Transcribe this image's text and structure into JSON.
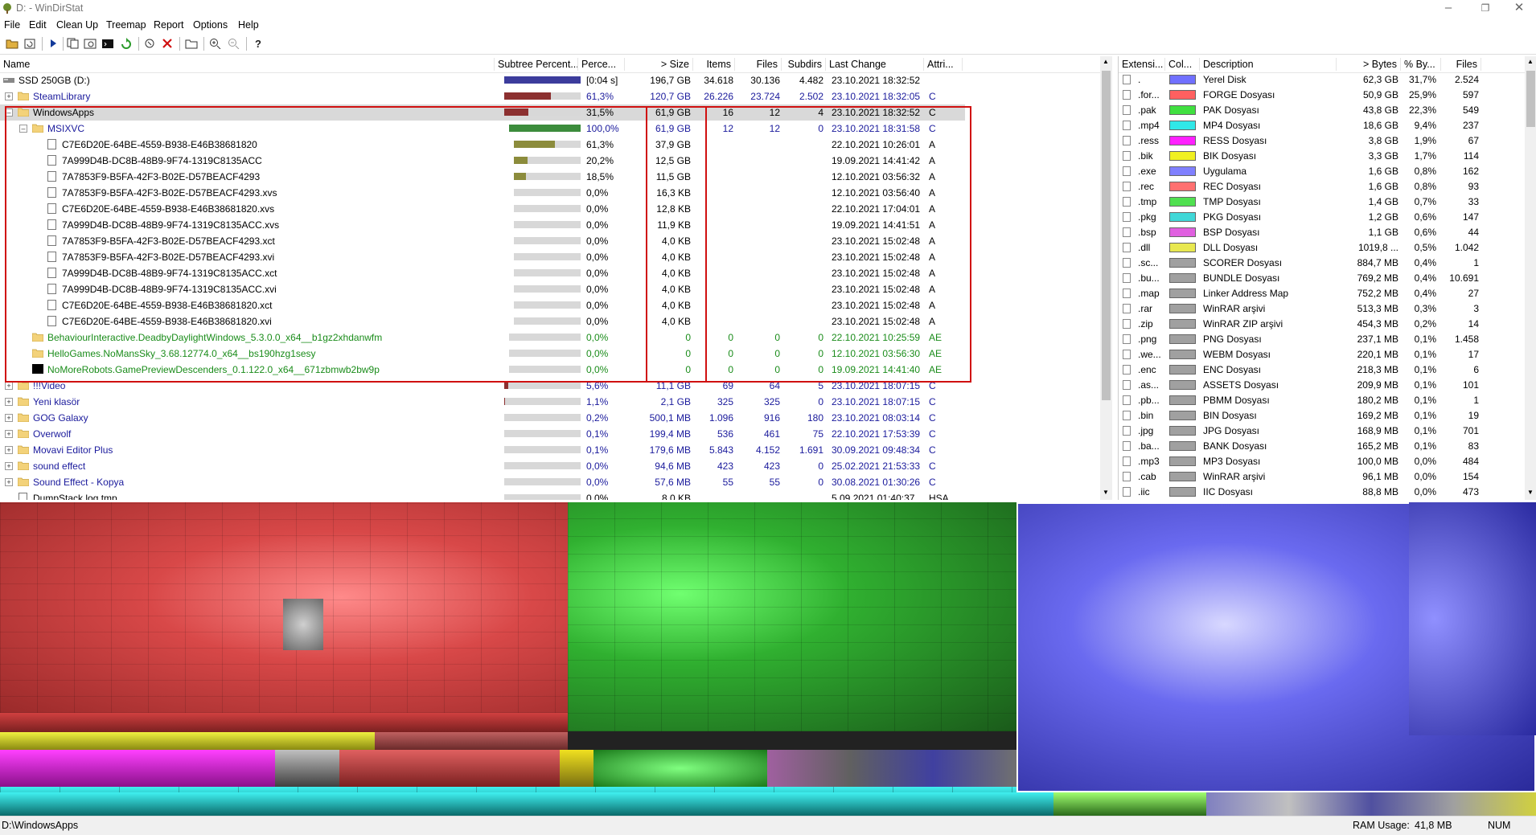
{
  "window": {
    "title": "D: - WinDirStat"
  },
  "menu": [
    "File",
    "Edit",
    "Clean Up",
    "Treemap",
    "Report",
    "Options",
    "Help"
  ],
  "toolbar": [
    "open-icon",
    "refresh-icon",
    "play-icon",
    "copy-icon",
    "explorer-icon",
    "cmd-icon",
    "cleanup-icon",
    "delete-icon",
    "folder-icon",
    "zoom-in-icon",
    "zoom-out-icon",
    "help-icon"
  ],
  "tree": {
    "columns": [
      "Name",
      "Subtree Percent...",
      "Perce...",
      "> Size",
      "Items",
      "Files",
      "Subdirs",
      "Last Change",
      "Attri..."
    ],
    "rows": [
      {
        "level": 0,
        "type": "drive",
        "name": "SSD 250GB (D:)",
        "bar": 1.0,
        "barColor": "#3c3c9c",
        "perc": "[0:04 s]",
        "size": "196,7 GB",
        "items": "34.618",
        "files": "30.136",
        "subdirs": "4.482",
        "last": "23.10.2021  18:32:52",
        "attr": ""
      },
      {
        "level": 1,
        "type": "folder",
        "expander": "+",
        "name": "SteamLibrary",
        "nameColor": "blue",
        "bar": 0.613,
        "barColor": "#8c3030",
        "perc": "61,3%",
        "size": "120,7 GB",
        "items": "26.226",
        "files": "23.724",
        "subdirs": "2.502",
        "last": "23.10.2021  18:32:05",
        "attr": "C"
      },
      {
        "level": 1,
        "type": "folder",
        "expander": "-",
        "name": "WindowsApps",
        "nameColor": "black",
        "selected": true,
        "bar": 0.315,
        "barColor": "#8c3030",
        "perc": "31,5%",
        "size": "61,9 GB",
        "items": "16",
        "files": "12",
        "subdirs": "4",
        "last": "23.10.2021  18:32:52",
        "attr": "C"
      },
      {
        "level": 2,
        "type": "folder",
        "expander": "-",
        "name": "MSIXVC",
        "nameColor": "blue",
        "bar": 1.0,
        "barColor": "#3c8c3c",
        "perc": "100,0%",
        "size": "61,9 GB",
        "items": "12",
        "files": "12",
        "subdirs": "0",
        "last": "23.10.2021  18:31:58",
        "attr": "C"
      },
      {
        "level": 3,
        "type": "file",
        "name": "C7E6D20E-64BE-4559-B938-E46B38681820",
        "bar": 0.613,
        "barColor": "#8c8c3c",
        "perc": "61,3%",
        "size": "37,9 GB",
        "items": "",
        "files": "",
        "subdirs": "",
        "last": "22.10.2021  10:26:01",
        "attr": "A"
      },
      {
        "level": 3,
        "type": "file",
        "name": "7A999D4B-DC8B-48B9-9F74-1319C8135ACC",
        "bar": 0.202,
        "barColor": "#8c8c3c",
        "perc": "20,2%",
        "size": "12,5 GB",
        "items": "",
        "files": "",
        "subdirs": "",
        "last": "19.09.2021  14:41:42",
        "attr": "A"
      },
      {
        "level": 3,
        "type": "file",
        "name": "7A7853F9-B5FA-42F3-B02E-D57BEACF4293",
        "bar": 0.185,
        "barColor": "#8c8c3c",
        "perc": "18,5%",
        "size": "11,5 GB",
        "items": "",
        "files": "",
        "subdirs": "",
        "last": "12.10.2021  03:56:32",
        "attr": "A"
      },
      {
        "level": 3,
        "type": "file",
        "name": "7A7853F9-B5FA-42F3-B02E-D57BEACF4293.xvs",
        "bar": 0,
        "barColor": "#8c8c3c",
        "perc": "0,0%",
        "size": "16,3 KB",
        "items": "",
        "files": "",
        "subdirs": "",
        "last": "12.10.2021  03:56:40",
        "attr": "A"
      },
      {
        "level": 3,
        "type": "file",
        "name": "C7E6D20E-64BE-4559-B938-E46B38681820.xvs",
        "bar": 0,
        "barColor": "#8c8c3c",
        "perc": "0,0%",
        "size": "12,8 KB",
        "items": "",
        "files": "",
        "subdirs": "",
        "last": "22.10.2021  17:04:01",
        "attr": "A"
      },
      {
        "level": 3,
        "type": "file",
        "name": "7A999D4B-DC8B-48B9-9F74-1319C8135ACC.xvs",
        "bar": 0,
        "barColor": "#8c8c3c",
        "perc": "0,0%",
        "size": "11,9 KB",
        "items": "",
        "files": "",
        "subdirs": "",
        "last": "19.09.2021  14:41:51",
        "attr": "A"
      },
      {
        "level": 3,
        "type": "file",
        "name": "7A7853F9-B5FA-42F3-B02E-D57BEACF4293.xct",
        "bar": 0,
        "barColor": "#8c8c3c",
        "perc": "0,0%",
        "size": "4,0 KB",
        "items": "",
        "files": "",
        "subdirs": "",
        "last": "23.10.2021  15:02:48",
        "attr": "A"
      },
      {
        "level": 3,
        "type": "file",
        "name": "7A7853F9-B5FA-42F3-B02E-D57BEACF4293.xvi",
        "bar": 0,
        "barColor": "#8c8c3c",
        "perc": "0,0%",
        "size": "4,0 KB",
        "items": "",
        "files": "",
        "subdirs": "",
        "last": "23.10.2021  15:02:48",
        "attr": "A"
      },
      {
        "level": 3,
        "type": "file",
        "name": "7A999D4B-DC8B-48B9-9F74-1319C8135ACC.xct",
        "bar": 0,
        "barColor": "#8c8c3c",
        "perc": "0,0%",
        "size": "4,0 KB",
        "items": "",
        "files": "",
        "subdirs": "",
        "last": "23.10.2021  15:02:48",
        "attr": "A"
      },
      {
        "level": 3,
        "type": "file",
        "name": "7A999D4B-DC8B-48B9-9F74-1319C8135ACC.xvi",
        "bar": 0,
        "barColor": "#8c8c3c",
        "perc": "0,0%",
        "size": "4,0 KB",
        "items": "",
        "files": "",
        "subdirs": "",
        "last": "23.10.2021  15:02:48",
        "attr": "A"
      },
      {
        "level": 3,
        "type": "file",
        "name": "C7E6D20E-64BE-4559-B938-E46B38681820.xct",
        "bar": 0,
        "barColor": "#8c8c3c",
        "perc": "0,0%",
        "size": "4,0 KB",
        "items": "",
        "files": "",
        "subdirs": "",
        "last": "23.10.2021  15:02:48",
        "attr": "A"
      },
      {
        "level": 3,
        "type": "file",
        "name": "C7E6D20E-64BE-4559-B938-E46B38681820.xvi",
        "bar": 0,
        "barColor": "#8c8c3c",
        "perc": "0,0%",
        "size": "4,0 KB",
        "items": "",
        "files": "",
        "subdirs": "",
        "last": "23.10.2021  15:02:48",
        "attr": "A"
      },
      {
        "level": 2,
        "type": "folder",
        "name": "BehaviourInteractive.DeadbyDaylightWindows_5.3.0.0_x64__b1gz2xhdanwfm",
        "nameColor": "green",
        "bar": 0,
        "barColor": "#3c8c3c",
        "perc": "0,0%",
        "size": "0",
        "items": "0",
        "files": "0",
        "subdirs": "0",
        "last": "22.10.2021  10:25:59",
        "attr": "AE",
        "attrColor": "green"
      },
      {
        "level": 2,
        "type": "folder",
        "name": "HelloGames.NoMansSky_3.68.12774.0_x64__bs190hzg1sesy",
        "nameColor": "green",
        "bar": 0,
        "barColor": "#3c8c3c",
        "perc": "0,0%",
        "size": "0",
        "items": "0",
        "files": "0",
        "subdirs": "0",
        "last": "12.10.2021  03:56:30",
        "attr": "AE",
        "attrColor": "green"
      },
      {
        "level": 2,
        "type": "blackfolder",
        "name": "NoMoreRobots.GamePreviewDescenders_0.1.122.0_x64__671zbmwb2bw9p",
        "nameColor": "green",
        "bar": 0,
        "barColor": "#3c8c3c",
        "perc": "0,0%",
        "size": "0",
        "items": "0",
        "files": "0",
        "subdirs": "0",
        "last": "19.09.2021  14:41:40",
        "attr": "AE",
        "attrColor": "green"
      },
      {
        "level": 1,
        "type": "folder",
        "expander": "+",
        "name": "!!!Video",
        "nameColor": "blue",
        "bar": 0.056,
        "barColor": "#8c3030",
        "perc": "5,6%",
        "size": "11,1 GB",
        "items": "69",
        "files": "64",
        "subdirs": "5",
        "last": "23.10.2021  18:07:15",
        "attr": "C"
      },
      {
        "level": 1,
        "type": "folder",
        "expander": "+",
        "name": "Yeni klasör",
        "nameColor": "blue",
        "bar": 0.011,
        "barColor": "#8c3030",
        "perc": "1,1%",
        "size": "2,1 GB",
        "items": "325",
        "files": "325",
        "subdirs": "0",
        "last": "23.10.2021  18:07:15",
        "attr": "C"
      },
      {
        "level": 1,
        "type": "folder",
        "expander": "+",
        "name": "GOG Galaxy",
        "nameColor": "blue",
        "bar": 0.002,
        "barColor": "#8c3030",
        "perc": "0,2%",
        "size": "500,1 MB",
        "items": "1.096",
        "files": "916",
        "subdirs": "180",
        "last": "23.10.2021  08:03:14",
        "attr": "C"
      },
      {
        "level": 1,
        "type": "folder",
        "expander": "+",
        "name": "Overwolf",
        "nameColor": "blue",
        "bar": 0.001,
        "barColor": "#8c3030",
        "perc": "0,1%",
        "size": "199,4 MB",
        "items": "536",
        "files": "461",
        "subdirs": "75",
        "last": "22.10.2021  17:53:39",
        "attr": "C"
      },
      {
        "level": 1,
        "type": "folder",
        "expander": "+",
        "name": "Movavi Editor Plus",
        "nameColor": "blue",
        "bar": 0.001,
        "barColor": "#8c3030",
        "perc": "0,1%",
        "size": "179,6 MB",
        "items": "5.843",
        "files": "4.152",
        "subdirs": "1.691",
        "last": "30.09.2021  09:48:34",
        "attr": "C"
      },
      {
        "level": 1,
        "type": "folder",
        "expander": "+",
        "name": "sound effect",
        "nameColor": "blue",
        "bar": 0,
        "barColor": "#8c3030",
        "perc": "0,0%",
        "size": "94,6 MB",
        "items": "423",
        "files": "423",
        "subdirs": "0",
        "last": "25.02.2021  21:53:33",
        "attr": "C"
      },
      {
        "level": 1,
        "type": "folder",
        "expander": "+",
        "name": "Sound Effect - Kopya",
        "nameColor": "blue",
        "bar": 0,
        "barColor": "#8c3030",
        "perc": "0,0%",
        "size": "57,6 MB",
        "items": "55",
        "files": "55",
        "subdirs": "0",
        "last": "30.08.2021  01:30:26",
        "attr": "C"
      },
      {
        "level": 1,
        "type": "file",
        "name": "DumpStack.log.tmp",
        "nameColor": "black",
        "bar": 0,
        "barColor": "#8c3030",
        "perc": "0,0%",
        "size": "8,0 KB",
        "items": "",
        "files": "",
        "subdirs": "",
        "last": "5.09.2021  01:40:37",
        "attr": "HSA"
      }
    ]
  },
  "extensions": {
    "columns": [
      "Extensi...",
      "Col...",
      "Description",
      "> Bytes",
      "% By...",
      "Files"
    ],
    "rows": [
      {
        "ext": ".",
        "color": "#7070ff",
        "desc": "Yerel Disk",
        "bytes": "62,3 GB",
        "pct": "31,7%",
        "files": "2.524"
      },
      {
        "ext": ".for...",
        "color": "#ff6060",
        "desc": "FORGE Dosyası",
        "bytes": "50,9 GB",
        "pct": "25,9%",
        "files": "597"
      },
      {
        "ext": ".pak",
        "color": "#40e040",
        "desc": "PAK Dosyası",
        "bytes": "43,8 GB",
        "pct": "22,3%",
        "files": "549"
      },
      {
        "ext": ".mp4",
        "color": "#30e8e8",
        "desc": "MP4 Dosyası",
        "bytes": "18,6 GB",
        "pct": "9,4%",
        "files": "237"
      },
      {
        "ext": ".ress",
        "color": "#ff20ff",
        "desc": "RESS Dosyası",
        "bytes": "3,8 GB",
        "pct": "1,9%",
        "files": "67"
      },
      {
        "ext": ".bik",
        "color": "#f0f020",
        "desc": "BIK Dosyası",
        "bytes": "3,3 GB",
        "pct": "1,7%",
        "files": "114"
      },
      {
        "ext": ".exe",
        "color": "#8080ff",
        "desc": "Uygulama",
        "bytes": "1,6 GB",
        "pct": "0,8%",
        "files": "162"
      },
      {
        "ext": ".rec",
        "color": "#ff7070",
        "desc": "REC Dosyası",
        "bytes": "1,6 GB",
        "pct": "0,8%",
        "files": "93"
      },
      {
        "ext": ".tmp",
        "color": "#50e050",
        "desc": "TMP Dosyası",
        "bytes": "1,4 GB",
        "pct": "0,7%",
        "files": "33"
      },
      {
        "ext": ".pkg",
        "color": "#40d8d8",
        "desc": "PKG Dosyası",
        "bytes": "1,2 GB",
        "pct": "0,6%",
        "files": "147"
      },
      {
        "ext": ".bsp",
        "color": "#e060e0",
        "desc": "BSP Dosyası",
        "bytes": "1,1 GB",
        "pct": "0,6%",
        "files": "44"
      },
      {
        "ext": ".dll",
        "color": "#e8e850",
        "desc": "DLL Dosyası",
        "bytes": "1019,8 ...",
        "pct": "0,5%",
        "files": "1.042"
      },
      {
        "ext": ".sc...",
        "color": "#a0a0a0",
        "desc": "SCORER Dosyası",
        "bytes": "884,7 MB",
        "pct": "0,4%",
        "files": "1"
      },
      {
        "ext": ".bu...",
        "color": "#a0a0a0",
        "desc": "BUNDLE Dosyası",
        "bytes": "769,2 MB",
        "pct": "0,4%",
        "files": "10.691"
      },
      {
        "ext": ".map",
        "color": "#a0a0a0",
        "desc": "Linker Address Map",
        "bytes": "752,2 MB",
        "pct": "0,4%",
        "files": "27"
      },
      {
        "ext": ".rar",
        "color": "#a0a0a0",
        "desc": "WinRAR arşivi",
        "bytes": "513,3 MB",
        "pct": "0,3%",
        "files": "3"
      },
      {
        "ext": ".zip",
        "color": "#a0a0a0",
        "desc": "WinRAR ZIP arşivi",
        "bytes": "454,3 MB",
        "pct": "0,2%",
        "files": "14"
      },
      {
        "ext": ".png",
        "color": "#a0a0a0",
        "desc": "PNG Dosyası",
        "bytes": "237,1 MB",
        "pct": "0,1%",
        "files": "1.458"
      },
      {
        "ext": ".we...",
        "color": "#a0a0a0",
        "desc": "WEBM Dosyası",
        "bytes": "220,1 MB",
        "pct": "0,1%",
        "files": "17"
      },
      {
        "ext": ".enc",
        "color": "#a0a0a0",
        "desc": "ENC Dosyası",
        "bytes": "218,3 MB",
        "pct": "0,1%",
        "files": "6"
      },
      {
        "ext": ".as...",
        "color": "#a0a0a0",
        "desc": "ASSETS Dosyası",
        "bytes": "209,9 MB",
        "pct": "0,1%",
        "files": "101"
      },
      {
        "ext": ".pb...",
        "color": "#a0a0a0",
        "desc": "PBMM Dosyası",
        "bytes": "180,2 MB",
        "pct": "0,1%",
        "files": "1"
      },
      {
        "ext": ".bin",
        "color": "#a0a0a0",
        "desc": "BIN Dosyası",
        "bytes": "169,2 MB",
        "pct": "0,1%",
        "files": "19"
      },
      {
        "ext": ".jpg",
        "color": "#a0a0a0",
        "desc": "JPG Dosyası",
        "bytes": "168,9 MB",
        "pct": "0,1%",
        "files": "701"
      },
      {
        "ext": ".ba...",
        "color": "#a0a0a0",
        "desc": "BANK Dosyası",
        "bytes": "165,2 MB",
        "pct": "0,1%",
        "files": "83"
      },
      {
        "ext": ".mp3",
        "color": "#a0a0a0",
        "desc": "MP3 Dosyası",
        "bytes": "100,0 MB",
        "pct": "0,0%",
        "files": "484"
      },
      {
        "ext": ".cab",
        "color": "#a0a0a0",
        "desc": "WinRAR arşivi",
        "bytes": "96,1 MB",
        "pct": "0,0%",
        "files": "154"
      },
      {
        "ext": ".iic",
        "color": "#a0a0a0",
        "desc": "IIC Dosyası",
        "bytes": "88,8 MB",
        "pct": "0,0%",
        "files": "473"
      }
    ]
  },
  "status": {
    "path": "D:\\WindowsApps",
    "ram_label": "RAM Usage:",
    "ram_value": "41,8 MB",
    "num": "NUM"
  }
}
